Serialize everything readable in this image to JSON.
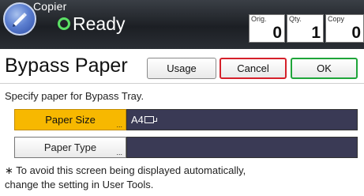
{
  "header": {
    "app_name": "Copier",
    "status": "Ready",
    "counters": [
      {
        "label": "Orig.",
        "value": "0"
      },
      {
        "label": "Qty.",
        "value": "1"
      },
      {
        "label": "Copy",
        "value": "0"
      }
    ]
  },
  "title_bar": {
    "title": "Bypass Paper",
    "usage_label": "Usage",
    "cancel_label": "Cancel",
    "ok_label": "OK"
  },
  "body": {
    "instruction": "Specify paper for Bypass Tray.",
    "rows": [
      {
        "label": "Paper Size",
        "value": "A4",
        "selected": true
      },
      {
        "label": "Paper Type",
        "value": "",
        "selected": false
      }
    ],
    "note_line1": "∗ To avoid this screen being displayed automatically,",
    "note_line2": "change the setting in User Tools."
  },
  "colors": {
    "selected": "#f7b800",
    "cancel_border": "#d5202a",
    "ok_border": "#1fa53a",
    "value_bg": "#3a3a55",
    "ready_icon": "#5be065"
  }
}
